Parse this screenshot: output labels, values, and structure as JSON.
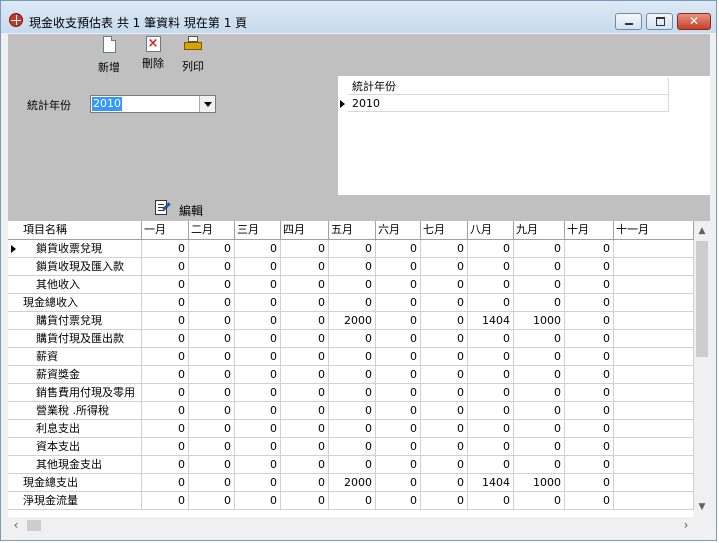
{
  "window": {
    "title": "現金收支預估表 共 1 筆資料 現在第 1 頁",
    "minimize_label": "",
    "close_label": "✕"
  },
  "toolbar": {
    "new_label": "新增",
    "delete_label": "刪除",
    "print_label": "列印"
  },
  "filter": {
    "year_label": "統計年份",
    "year_value": "2010"
  },
  "year_grid": {
    "header": "統計年份",
    "rows": [
      "2010"
    ]
  },
  "editbar": {
    "label": "編輯"
  },
  "grid": {
    "columns": [
      "項目名稱",
      "一月",
      "二月",
      "三月",
      "四月",
      "五月",
      "六月",
      "七月",
      "八月",
      "九月",
      "十月",
      "十一月"
    ],
    "rows": [
      {
        "name": "鎖貨收票兌現",
        "indent": true,
        "values": [
          "0",
          "0",
          "0",
          "0",
          "0",
          "0",
          "0",
          "0",
          "0",
          "0"
        ]
      },
      {
        "name": "鎖貨收現及匯入款",
        "indent": true,
        "values": [
          "0",
          "0",
          "0",
          "0",
          "0",
          "0",
          "0",
          "0",
          "0",
          "0"
        ]
      },
      {
        "name": "其他收入",
        "indent": true,
        "values": [
          "0",
          "0",
          "0",
          "0",
          "0",
          "0",
          "0",
          "0",
          "0",
          "0"
        ]
      },
      {
        "name": "現金總收入",
        "indent": false,
        "values": [
          "0",
          "0",
          "0",
          "0",
          "0",
          "0",
          "0",
          "0",
          "0",
          "0"
        ]
      },
      {
        "name": "購貨付票兌現",
        "indent": true,
        "values": [
          "0",
          "0",
          "0",
          "0",
          "2000",
          "0",
          "0",
          "1404",
          "1000",
          "0"
        ]
      },
      {
        "name": "購貨付現及匯出款",
        "indent": true,
        "values": [
          "0",
          "0",
          "0",
          "0",
          "0",
          "0",
          "0",
          "0",
          "0",
          "0"
        ]
      },
      {
        "name": "薪資",
        "indent": true,
        "values": [
          "0",
          "0",
          "0",
          "0",
          "0",
          "0",
          "0",
          "0",
          "0",
          "0"
        ]
      },
      {
        "name": "薪資獎金",
        "indent": true,
        "values": [
          "0",
          "0",
          "0",
          "0",
          "0",
          "0",
          "0",
          "0",
          "0",
          "0"
        ]
      },
      {
        "name": "銷售費用付現及零用",
        "indent": true,
        "values": [
          "0",
          "0",
          "0",
          "0",
          "0",
          "0",
          "0",
          "0",
          "0",
          "0"
        ]
      },
      {
        "name": "營業稅 .所得稅",
        "indent": true,
        "values": [
          "0",
          "0",
          "0",
          "0",
          "0",
          "0",
          "0",
          "0",
          "0",
          "0"
        ]
      },
      {
        "name": "利息支出",
        "indent": true,
        "values": [
          "0",
          "0",
          "0",
          "0",
          "0",
          "0",
          "0",
          "0",
          "0",
          "0"
        ]
      },
      {
        "name": "資本支出",
        "indent": true,
        "values": [
          "0",
          "0",
          "0",
          "0",
          "0",
          "0",
          "0",
          "0",
          "0",
          "0"
        ]
      },
      {
        "name": "其他現金支出",
        "indent": true,
        "values": [
          "0",
          "0",
          "0",
          "0",
          "0",
          "0",
          "0",
          "0",
          "0",
          "0"
        ]
      },
      {
        "name": "現金總支出",
        "indent": false,
        "values": [
          "0",
          "0",
          "0",
          "0",
          "2000",
          "0",
          "0",
          "1404",
          "1000",
          "0"
        ]
      },
      {
        "name": "淨現金流量",
        "indent": false,
        "values": [
          "0",
          "0",
          "0",
          "0",
          "0",
          "0",
          "0",
          "0",
          "0",
          "0"
        ]
      }
    ]
  },
  "scroll": {
    "up": "▲",
    "down": "▼",
    "left": "‹",
    "right": "›"
  }
}
